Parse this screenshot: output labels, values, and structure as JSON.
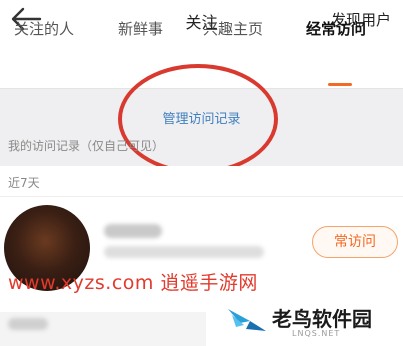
{
  "header": {
    "back_icon": "back-arrow-icon",
    "title": "关注",
    "discover_label": "发现用户"
  },
  "tabs": [
    {
      "label": "关注的人",
      "active": false
    },
    {
      "label": "新鲜事",
      "active": false
    },
    {
      "label": "兴趣主页",
      "active": false
    },
    {
      "label": "经常访问",
      "active": true
    }
  ],
  "manage": {
    "label": "管理访问记录"
  },
  "records_note": "我的访问记录（仅自己可见）",
  "recent_section": {
    "label": "近7天"
  },
  "visit_button": {
    "label": "常访问"
  },
  "watermark": {
    "text": "www.xyzs.com 逍遥手游网"
  },
  "logo": {
    "name": "老鸟软件园",
    "sub": "LNQS.NET"
  },
  "colors": {
    "accent": "#f26a25",
    "link": "#3e7fbf",
    "annotation": "#d93a30"
  }
}
